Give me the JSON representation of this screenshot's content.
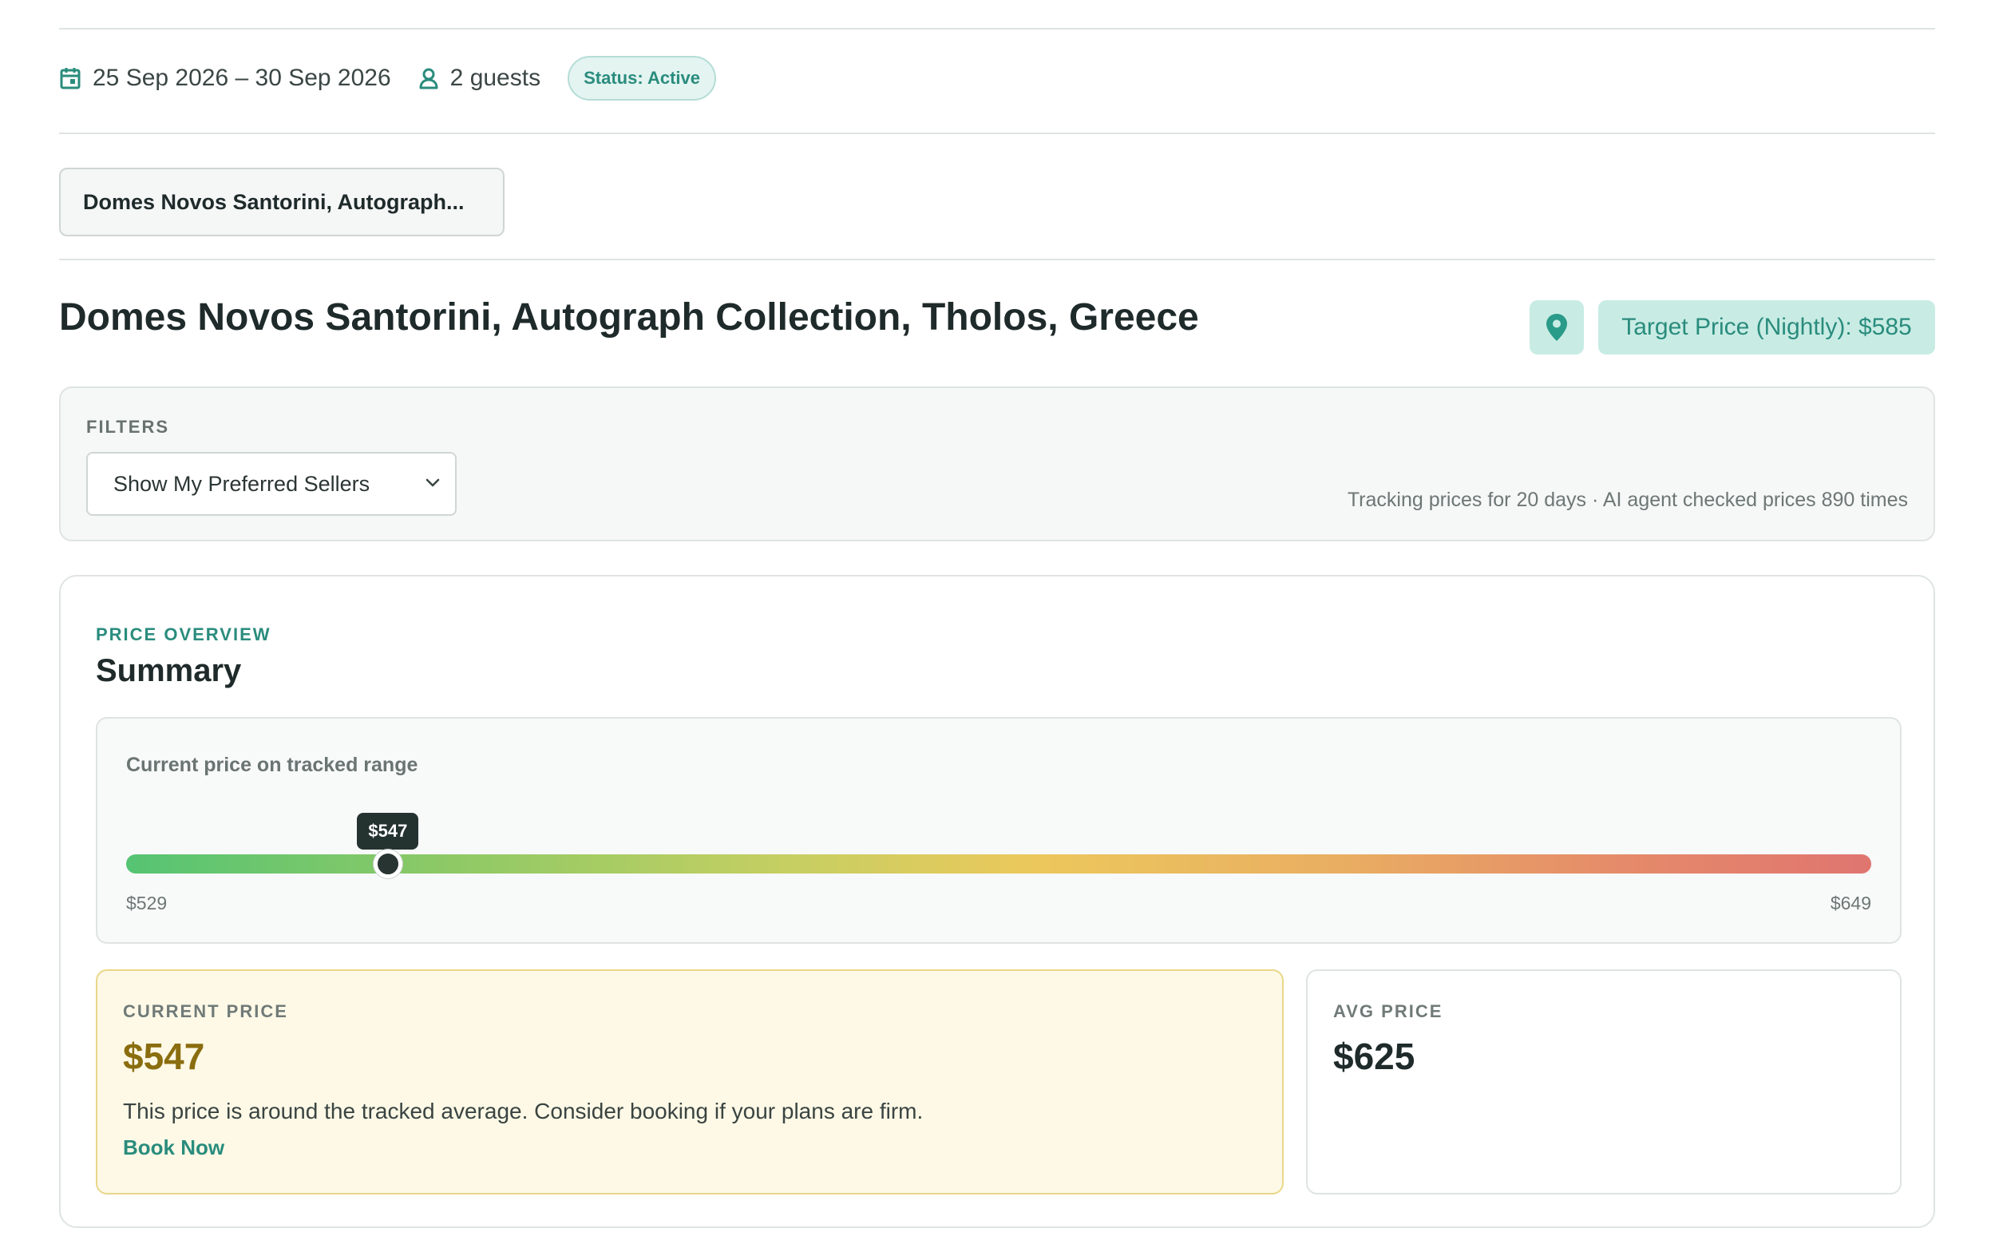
{
  "trip": {
    "dates": "25 Sep 2026 – 30 Sep 2026",
    "guests": "2 guests",
    "status": "Status: Active"
  },
  "hotel_tab": {
    "label": "Domes Novos Santorini, Autograph..."
  },
  "header": {
    "title": "Domes Novos Santorini, Autograph Collection, Tholos, Greece",
    "target_price": "Target Price (Nightly): $585"
  },
  "filters": {
    "label": "FILTERS",
    "seller_select": "Show My Preferred Sellers",
    "tracking": "Tracking prices for 20 days · AI agent checked prices 890 times"
  },
  "summary": {
    "overview_label": "PRICE OVERVIEW",
    "title": "Summary",
    "range": {
      "label": "Current price on tracked range",
      "min": 529,
      "max": 649,
      "current": 547,
      "min_label": "$529",
      "max_label": "$649",
      "current_label": "$547"
    },
    "current_price": {
      "label": "CURRENT PRICE",
      "value": "$547",
      "advice": "This price is around the tracked average. Consider booking if your plans are firm.",
      "action": "Book Now"
    },
    "avg_price": {
      "label": "AVG PRICE",
      "value": "$625"
    }
  },
  "icons": {
    "dates": "calendar-icon",
    "guests": "user-icon",
    "map": "map-pin-icon",
    "select": "chevron-down-icon"
  },
  "colors": {
    "accent": "#2a8c7d",
    "accent_bg": "#c8ece4",
    "current_price": "#8a6d0f",
    "current_card_bg": "#fdf9e6"
  }
}
